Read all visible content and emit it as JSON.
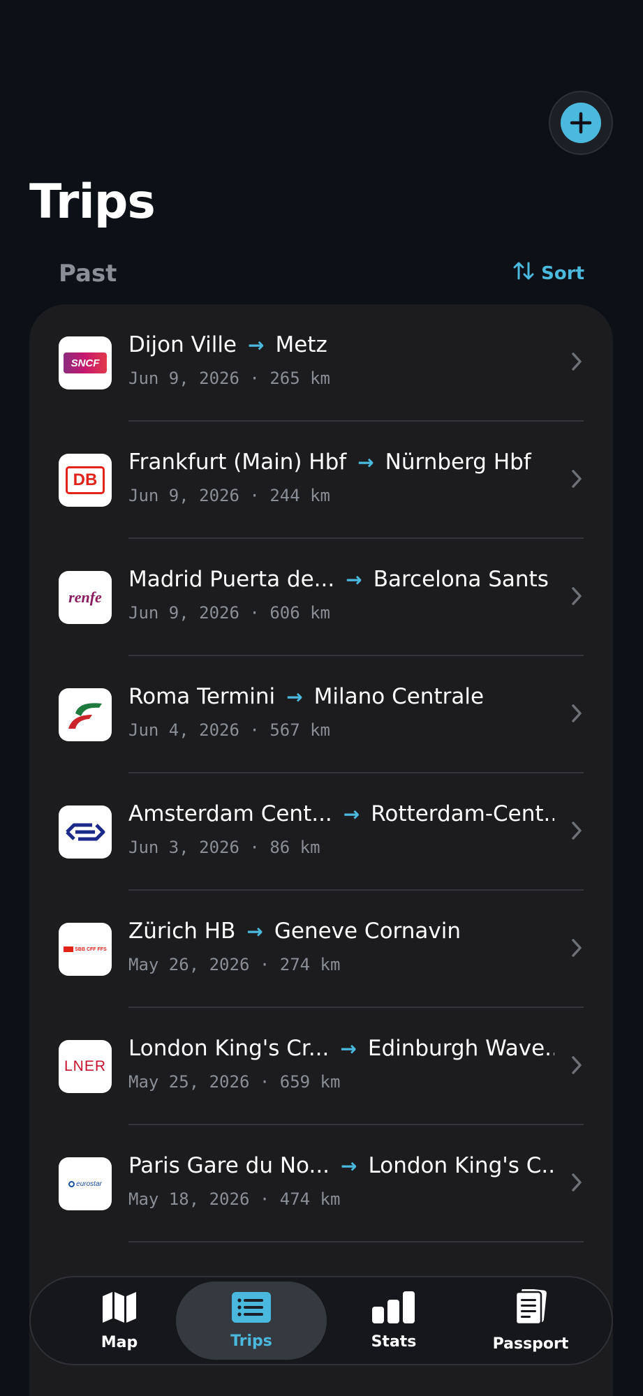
{
  "header": {
    "title": "Trips",
    "add_icon": "plus-icon",
    "accent": "#4bb8de"
  },
  "section": {
    "label": "Past",
    "sort_label": "Sort"
  },
  "trips": [
    {
      "from": "Dijon Ville",
      "to": "Metz",
      "date": "Jun 9, 2026",
      "distance": "265 km",
      "operator": "SNCF",
      "logo_text": "SNCF"
    },
    {
      "from": "Frankfurt (Main) Hbf",
      "to": "Nürnberg Hbf",
      "date": "Jun 9, 2026",
      "distance": "244 km",
      "operator": "DB",
      "logo_text": "DB"
    },
    {
      "from": "Madrid Puerta de...",
      "to": "Barcelona Sants",
      "date": "Jun 9, 2026",
      "distance": "606 km",
      "operator": "Renfe",
      "logo_text": "renfe"
    },
    {
      "from": "Roma Termini",
      "to": "Milano Centrale",
      "date": "Jun 4, 2026",
      "distance": "567 km",
      "operator": "Trenitalia",
      "logo_text": ""
    },
    {
      "from": "Amsterdam Cent...",
      "to": "Rotterdam-Cent...",
      "date": "Jun 3, 2026",
      "distance": "86 km",
      "operator": "NS",
      "logo_text": ""
    },
    {
      "from": "Zürich HB",
      "to": "Geneve Cornavin",
      "date": "May 26, 2026",
      "distance": "274 km",
      "operator": "SBB",
      "logo_text": "SBB CFF FFS"
    },
    {
      "from": "London King's Cr...",
      "to": "Edinburgh Wave...",
      "date": "May 25, 2026",
      "distance": "659 km",
      "operator": "LNER",
      "logo_text": "LNER"
    },
    {
      "from": "Paris Gare du No...",
      "to": "London King's C...",
      "date": "May 18, 2026",
      "distance": "474 km",
      "operator": "Eurostar",
      "logo_text": "eurostar"
    }
  ],
  "tabbar": {
    "active": "Trips",
    "tabs": [
      {
        "label": "Map",
        "icon": "map-icon"
      },
      {
        "label": "Trips",
        "icon": "list-icon"
      },
      {
        "label": "Stats",
        "icon": "bar-chart-icon"
      },
      {
        "label": "Passport",
        "icon": "passport-icon"
      }
    ]
  }
}
